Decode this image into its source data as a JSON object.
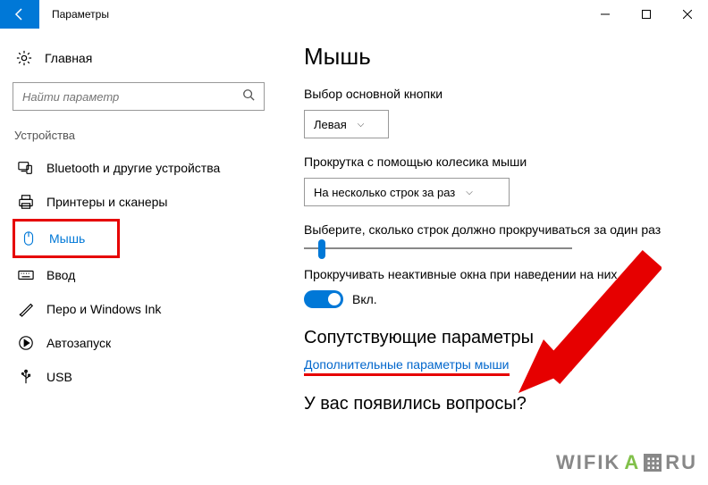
{
  "window": {
    "title": "Параметры"
  },
  "sidebar": {
    "home": "Главная",
    "search_placeholder": "Найти параметр",
    "category": "Устройства",
    "items": [
      {
        "label": "Bluetooth и другие устройства"
      },
      {
        "label": "Принтеры и сканеры"
      },
      {
        "label": "Мышь"
      },
      {
        "label": "Ввод"
      },
      {
        "label": "Перо и Windows Ink"
      },
      {
        "label": "Автозапуск"
      },
      {
        "label": "USB"
      }
    ]
  },
  "main": {
    "heading": "Мышь",
    "primary_button_label": "Выбор основной кнопки",
    "primary_button_value": "Левая",
    "scroll_method_label": "Прокрутка с помощью колесика мыши",
    "scroll_method_value": "На несколько строк за раз",
    "scroll_lines_label": "Выберите, сколько строк должно прокручиваться за один раз",
    "inactive_windows_label": "Прокручивать неактивные окна при наведении на них",
    "toggle_state": "Вкл.",
    "related_heading": "Сопутствующие параметры",
    "advanced_link": "Дополнительные параметры мыши",
    "questions_heading": "У вас появились вопросы?"
  },
  "watermark": {
    "p1": "WIFIK",
    "p2": "A",
    "p3": "RU"
  }
}
